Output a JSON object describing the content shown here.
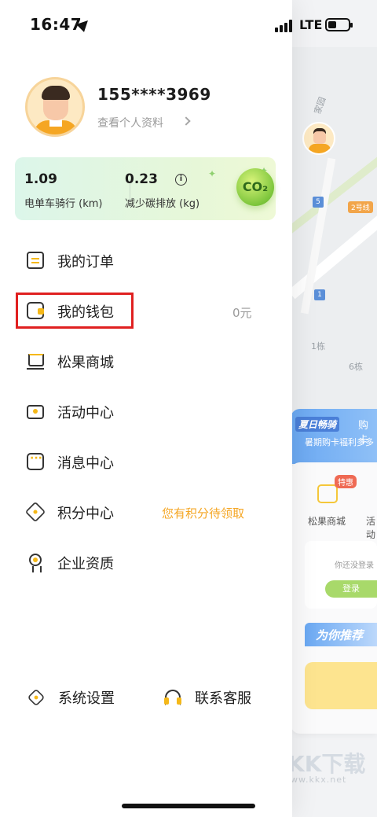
{
  "status_bar": {
    "time": "16:47",
    "network": "LTE"
  },
  "profile": {
    "phone": "155****3969",
    "view_profile": "查看个人资料"
  },
  "eco": {
    "ride_value": "1.09",
    "ride_label": "电单车骑行 (km)",
    "carbon_value": "0.23",
    "carbon_label": "减少碳排放 (kg)",
    "info_glyph": "i",
    "badge_text": "CO₂"
  },
  "menu": {
    "orders": "我的订单",
    "wallet": "我的钱包",
    "wallet_balance": "0元",
    "mall": "松果商城",
    "activity": "活动中心",
    "messages": "消息中心",
    "points": "积分中心",
    "points_hint": "您有积分待领取",
    "qualification": "企业资质"
  },
  "bottom": {
    "settings": "系统设置",
    "support": "联系客服"
  },
  "background": {
    "map_labels": [
      "家园",
      "1栋",
      "6栋"
    ],
    "line_badge": "2号线",
    "badge_5": "5",
    "badge_1": "1",
    "promo_tag": "夏日畅骑",
    "promo_title": "购卡",
    "promo_sub": "暑期购卡福利多多",
    "tehui": "特惠",
    "mall_label": "松果商城",
    "activity_label": "活动",
    "not_logged_in": "你还没登录",
    "login_button": "登录",
    "recommend": "为你推荐",
    "watermark_big": "KK下载",
    "watermark": "www.kkx.net"
  },
  "colors": {
    "accent_yellow": "#f5b818",
    "hint_orange": "#f5a623",
    "highlight_red": "#e02020",
    "eco_green": "#7dc63c"
  }
}
